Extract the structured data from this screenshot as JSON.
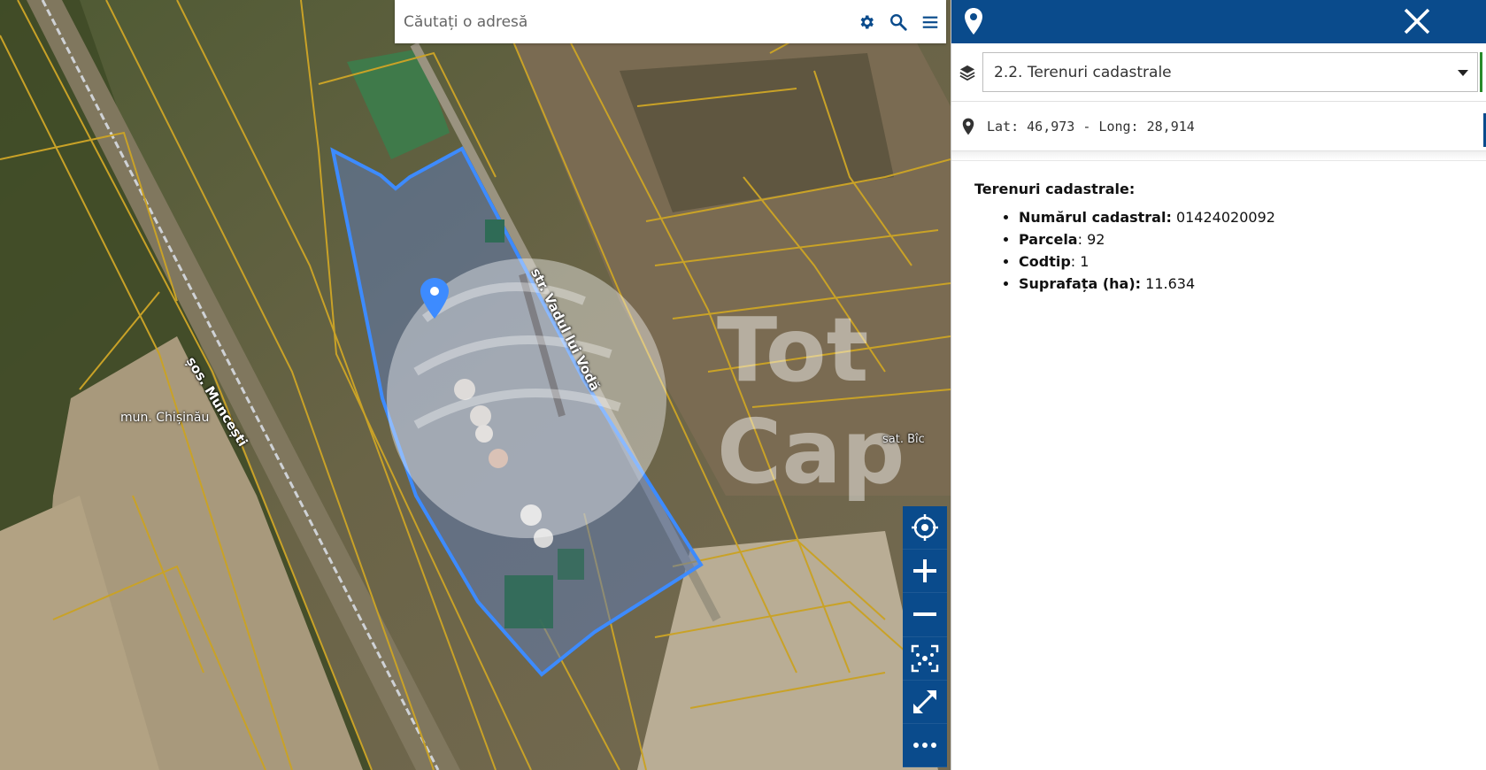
{
  "search": {
    "placeholder": "Căutați o adresă",
    "settings_icon": "gear-icon",
    "search_icon": "search-icon",
    "menu_icon": "hamburger-menu-icon"
  },
  "map": {
    "labels": {
      "city": "mun. Chișinău",
      "road": "șos. Muncești",
      "street": "str. Vadul lui Vodă",
      "village": "sat. Bîc"
    },
    "watermark": "TotCap",
    "toolbar": [
      "locate-icon",
      "zoom-in-icon",
      "zoom-out-icon",
      "fit-extent-icon",
      "fullscreen-icon",
      "more-icon"
    ]
  },
  "panel": {
    "header_icon": "map-pin-icon",
    "close_icon": "close-icon",
    "layer": "2.2. Terenuri cadastrale",
    "coordinates": "Lat: 46,973 - Long: 28,914",
    "info_title": "Terenuri cadastrale:",
    "fields": [
      {
        "label": "Numărul cadastral:",
        "value": " 01424020092"
      },
      {
        "label": "Parcela",
        "value": ": 92"
      },
      {
        "label": "Codtip",
        "value": ": 1"
      },
      {
        "label": "Suprafața (ha):",
        "value": " 11.634"
      }
    ]
  },
  "colors": {
    "brand": "#0a4b8c",
    "selection": "#3d8bff",
    "parcel_lines": "#c9a227"
  }
}
